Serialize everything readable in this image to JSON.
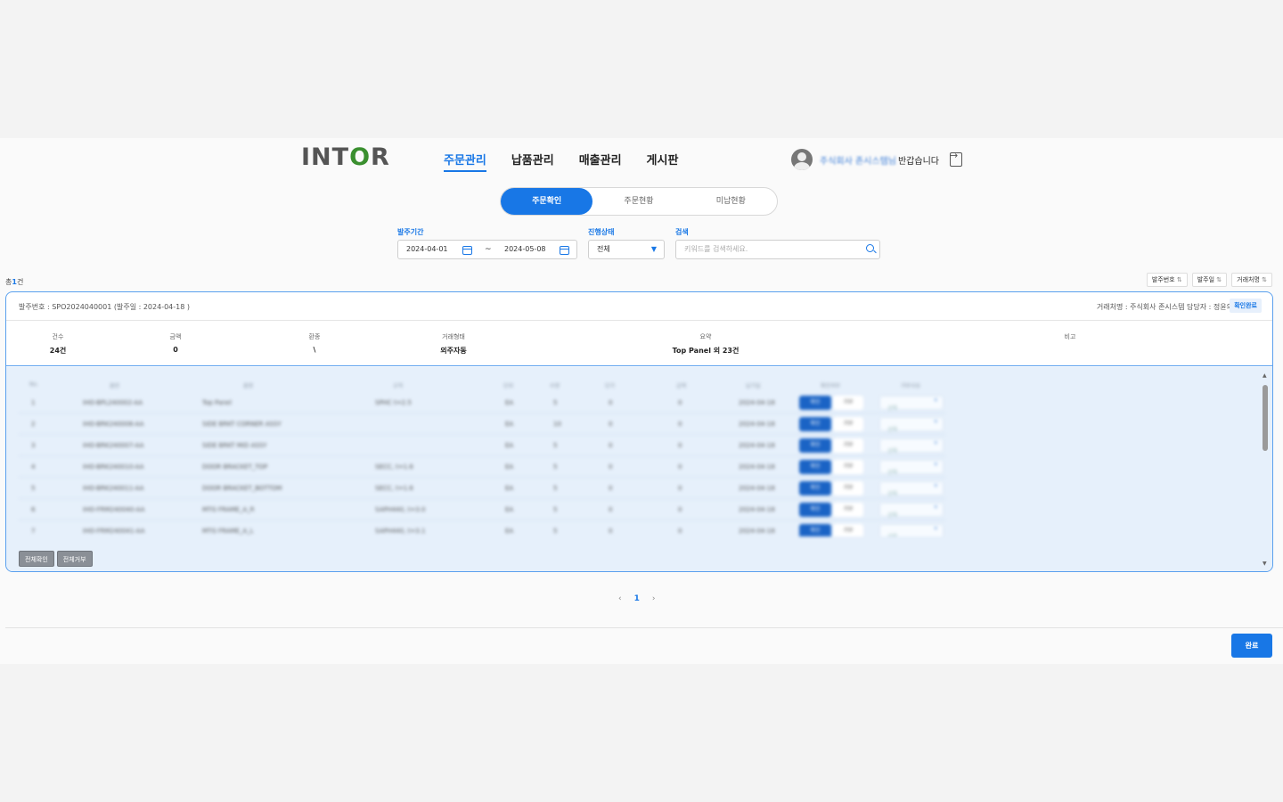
{
  "header": {
    "logo": [
      "INT",
      "O",
      "R"
    ],
    "nav": [
      "주문관리",
      "납품관리",
      "매출관리",
      "게시판"
    ],
    "user_name": "주식회사 존시스템님",
    "greeting": "반갑습니다"
  },
  "tabs": [
    "주문확인",
    "주문현황",
    "미납현황"
  ],
  "filters": {
    "period_label": "발주기간",
    "start_date": "2024-04-01",
    "tilde": "~",
    "end_date": "2024-05-08",
    "status_label": "진행상태",
    "status_value": "전체",
    "search_label": "검색",
    "search_placeholder": "키워드를 검색하세요."
  },
  "total": {
    "prefix": "총",
    "count": "1",
    "suffix": "건"
  },
  "sorts": [
    "발주번호",
    "발주일",
    "거래처명"
  ],
  "order": {
    "order_no": "발주번호 : SPO2024040001 (발주일 : 2024-04-18 )",
    "meta": "거래처명 : 주식회사 존시스템   담당자 : 정윤의",
    "status": "확인완료",
    "summary": [
      {
        "label": "건수",
        "value": "24건"
      },
      {
        "label": "금액",
        "value": "0"
      },
      {
        "label": "환종",
        "value": "\\"
      },
      {
        "label": "거래형태",
        "value": "외주자동"
      },
      {
        "label": "요약",
        "value": "Top Panel 외 23건"
      },
      {
        "label": "비고",
        "value": ""
      }
    ]
  },
  "grid": {
    "headers": [
      "No.",
      "품번",
      "품명",
      "규격",
      "단위",
      "수량",
      "단가",
      "금액",
      "납기일",
      "확인여부",
      "거부사유"
    ],
    "rows": [
      [
        "1",
        "IHO-BPL240002-AA",
        "Top Panel",
        "SPHC t=2.5",
        "EA",
        "5",
        "0",
        "0",
        "2024-04-18"
      ],
      [
        "2",
        "IHO-BRK240006-AA",
        "SIDE BRKT CORNER ASSY",
        "",
        "EA",
        "10",
        "0",
        "0",
        "2024-04-18"
      ],
      [
        "3",
        "IHO-BRK240007-AA",
        "SIDE BRKT MID ASSY",
        "",
        "EA",
        "5",
        "0",
        "0",
        "2024-04-18"
      ],
      [
        "4",
        "IHO-BRK240010-AA",
        "DOOR BRACKET_TOP",
        "SECC, t=1.6",
        "EA",
        "5",
        "0",
        "0",
        "2024-04-18"
      ],
      [
        "5",
        "IHO-BRK240011-AA",
        "DOOR BRACKET_BOTTOM",
        "SECC, t=1.6",
        "EA",
        "5",
        "0",
        "0",
        "2024-04-18"
      ],
      [
        "6",
        "IHO-FRM240040-AA",
        "MTG FRAME_A_R",
        "SAPH440, t=3.0",
        "EA",
        "5",
        "0",
        "0",
        "2024-04-18"
      ],
      [
        "7",
        "IHO-FRM240041-AA",
        "MTG FRAME_A_L",
        "SAPH440, t=3.1",
        "EA",
        "5",
        "0",
        "0",
        "2024-04-18"
      ]
    ],
    "confirm_label": "확인",
    "reject_label": "거부",
    "reason_placeholder": "선택"
  },
  "bulk": [
    "전체확인",
    "전체거부"
  ],
  "pagination": {
    "prev": "‹",
    "page": "1",
    "next": "›"
  },
  "done_label": "완료",
  "colors": {
    "accent": "#1877e6",
    "card_border": "#5aa0ee",
    "grid_bg": "#e6f0fb",
    "logo_green": "#3a8f2f"
  }
}
